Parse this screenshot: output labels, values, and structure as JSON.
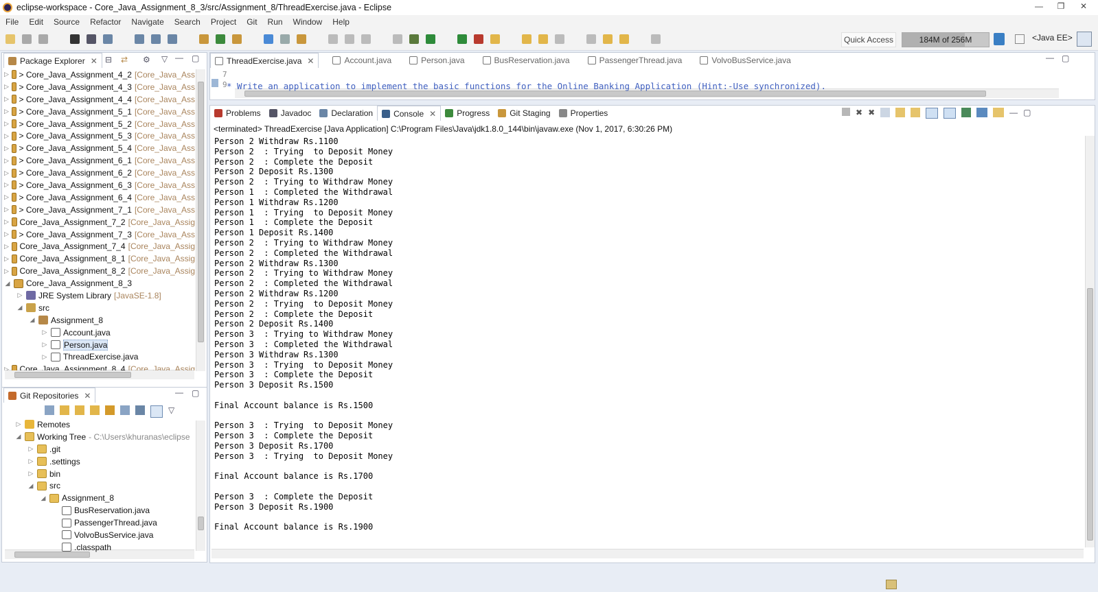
{
  "window": {
    "title": "eclipse-workspace - Core_Java_Assignment_8_3/src/Assignment_8/ThreadExercise.java - Eclipse"
  },
  "menu": [
    "File",
    "Edit",
    "Source",
    "Refactor",
    "Navigate",
    "Search",
    "Project",
    "Git",
    "Run",
    "Window",
    "Help"
  ],
  "toolbar": {
    "quick_access": "Quick Access",
    "heap": "184M of 256M",
    "heap_fraction": 0.72,
    "perspective": "<Java EE>"
  },
  "package_explorer": {
    "title": "Package Explorer",
    "items": [
      {
        "label": "> Core_Java_Assignment_4_2",
        "dec": "[Core_Java_Ass",
        "level": 0,
        "icon": "project"
      },
      {
        "label": "> Core_Java_Assignment_4_3",
        "dec": "[Core_Java_Ass",
        "level": 0,
        "icon": "project"
      },
      {
        "label": "> Core_Java_Assignment_4_4",
        "dec": "[Core_Java_Ass",
        "level": 0,
        "icon": "project"
      },
      {
        "label": "> Core_Java_Assignment_5_1",
        "dec": "[Core_Java_Ass",
        "level": 0,
        "icon": "project"
      },
      {
        "label": "> Core_Java_Assignment_5_2",
        "dec": "[Core_Java_Ass",
        "level": 0,
        "icon": "project"
      },
      {
        "label": "> Core_Java_Assignment_5_3",
        "dec": "[Core_Java_Ass",
        "level": 0,
        "icon": "project"
      },
      {
        "label": "> Core_Java_Assignment_5_4",
        "dec": "[Core_Java_Ass",
        "level": 0,
        "icon": "project"
      },
      {
        "label": "> Core_Java_Assignment_6_1",
        "dec": "[Core_Java_Ass",
        "level": 0,
        "icon": "project"
      },
      {
        "label": "> Core_Java_Assignment_6_2",
        "dec": "[Core_Java_Ass",
        "level": 0,
        "icon": "project"
      },
      {
        "label": "> Core_Java_Assignment_6_3",
        "dec": "[Core_Java_Ass",
        "level": 0,
        "icon": "project"
      },
      {
        "label": "> Core_Java_Assignment_6_4",
        "dec": "[Core_Java_Ass",
        "level": 0,
        "icon": "project"
      },
      {
        "label": "> Core_Java_Assignment_7_1",
        "dec": "[Core_Java_Ass",
        "level": 0,
        "icon": "project"
      },
      {
        "label": "Core_Java_Assignment_7_2",
        "dec": "[Core_Java_Assig",
        "level": 0,
        "icon": "project"
      },
      {
        "label": "> Core_Java_Assignment_7_3",
        "dec": "[Core_Java_Ass",
        "level": 0,
        "icon": "project"
      },
      {
        "label": "Core_Java_Assignment_7_4",
        "dec": "[Core_Java_Assig",
        "level": 0,
        "icon": "project"
      },
      {
        "label": "Core_Java_Assignment_8_1",
        "dec": "[Core_Java_Assig",
        "level": 0,
        "icon": "project"
      },
      {
        "label": "Core_Java_Assignment_8_2",
        "dec": "[Core_Java_Assig",
        "level": 0,
        "icon": "project"
      },
      {
        "label": "Core_Java_Assignment_8_3",
        "dec": "",
        "level": 0,
        "icon": "project",
        "open": true
      },
      {
        "label": "JRE System Library",
        "dec": "[JavaSE-1.8]",
        "level": 1,
        "icon": "lib"
      },
      {
        "label": "src",
        "dec": "",
        "level": 1,
        "icon": "src",
        "open": true
      },
      {
        "label": "Assignment_8",
        "dec": "",
        "level": 2,
        "icon": "pkg",
        "open": true
      },
      {
        "label": "Account.java",
        "dec": "",
        "level": 3,
        "icon": "java"
      },
      {
        "label": "Person.java",
        "dec": "",
        "level": 3,
        "icon": "java",
        "selected": true
      },
      {
        "label": "ThreadExercise.java",
        "dec": "",
        "level": 3,
        "icon": "java"
      },
      {
        "label": "Core_Java_Assignment_8_4",
        "dec": "[Core_Java_Assig",
        "level": 0,
        "icon": "project"
      }
    ]
  },
  "git_repos": {
    "title": "Git Repositories",
    "items": [
      {
        "label": "Remotes",
        "dec": "",
        "level": 1,
        "icon": "cyl"
      },
      {
        "label": "Working Tree",
        "dec": "- C:\\Users\\khuranas\\eclipse",
        "level": 1,
        "icon": "fold",
        "open": true
      },
      {
        "label": ".git",
        "dec": "",
        "level": 2,
        "icon": "fold"
      },
      {
        "label": ".settings",
        "dec": "",
        "level": 2,
        "icon": "fold"
      },
      {
        "label": "bin",
        "dec": "",
        "level": 2,
        "icon": "fold"
      },
      {
        "label": "src",
        "dec": "",
        "level": 2,
        "icon": "fold",
        "open": true
      },
      {
        "label": "Assignment_8",
        "dec": "",
        "level": 3,
        "icon": "fold",
        "open": true
      },
      {
        "label": "BusReservation.java",
        "dec": "",
        "level": 4,
        "icon": "java"
      },
      {
        "label": "PassengerThread.java",
        "dec": "",
        "level": 4,
        "icon": "java"
      },
      {
        "label": "VolvoBusService.java",
        "dec": "",
        "level": 4,
        "icon": "java"
      },
      {
        "label": ".classpath",
        "dec": "",
        "level": 4,
        "icon": "java"
      }
    ]
  },
  "editor": {
    "tabs": [
      "ThreadExercise.java",
      "Account.java",
      "Person.java",
      "BusReservation.java",
      "PassengerThread.java",
      "VolvoBusService.java"
    ],
    "line_numbers": [
      "7",
      "9"
    ],
    "comment": "* Write an application to implement the basic functions for the Online Banking Application (Hint:-Use synchronized)."
  },
  "bottom_tabs": [
    "Problems",
    "Javadoc",
    "Declaration",
    "Console",
    "Progress",
    "Git Staging",
    "Properties"
  ],
  "console": {
    "header": "<terminated> ThreadExercise [Java Application] C:\\Program Files\\Java\\jdk1.8.0_144\\bin\\javaw.exe (Nov 1, 2017, 6:30:26 PM)",
    "lines": [
      "Person 2 Withdraw Rs.1100",
      "Person 2  : Trying  to Deposit Money",
      "Person 2  : Complete the Deposit",
      "Person 2 Deposit Rs.1300",
      "Person 2  : Trying to Withdraw Money",
      "Person 1  : Completed the Withdrawal",
      "Person 1 Withdraw Rs.1200",
      "Person 1  : Trying  to Deposit Money",
      "Person 1  : Complete the Deposit",
      "Person 1 Deposit Rs.1400",
      "Person 2  : Trying to Withdraw Money",
      "Person 2  : Completed the Withdrawal",
      "Person 2 Withdraw Rs.1300",
      "Person 2  : Trying to Withdraw Money",
      "Person 2  : Completed the Withdrawal",
      "Person 2 Withdraw Rs.1200",
      "Person 2  : Trying  to Deposit Money",
      "Person 2  : Complete the Deposit",
      "Person 2 Deposit Rs.1400",
      "Person 3  : Trying to Withdraw Money",
      "Person 3  : Completed the Withdrawal",
      "Person 3 Withdraw Rs.1300",
      "Person 3  : Trying  to Deposit Money",
      "Person 3  : Complete the Deposit",
      "Person 3 Deposit Rs.1500",
      "",
      "Final Account balance is Rs.1500",
      "",
      "Person 3  : Trying  to Deposit Money",
      "Person 3  : Complete the Deposit",
      "Person 3 Deposit Rs.1700",
      "Person 3  : Trying  to Deposit Money",
      "",
      "Final Account balance is Rs.1700",
      "",
      "Person 3  : Complete the Deposit",
      "Person 3 Deposit Rs.1900",
      "",
      "Final Account balance is Rs.1900"
    ]
  }
}
